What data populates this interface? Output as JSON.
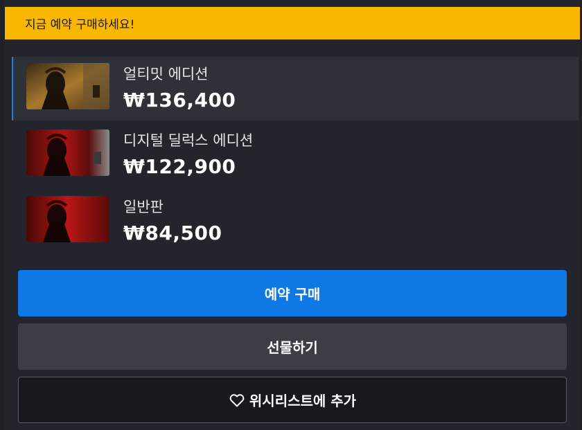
{
  "banner": {
    "text": "지금 예약 구매하세요!"
  },
  "editions": [
    {
      "name": "얼티밋 에디션",
      "price": "₩136,400",
      "selected": true,
      "thumb_icon": "ultimate-edition-art"
    },
    {
      "name": "디지털 딜럭스 에디션",
      "price": "₩122,900",
      "selected": false,
      "thumb_icon": "deluxe-edition-art"
    },
    {
      "name": "일반판",
      "price": "₩84,500",
      "selected": false,
      "thumb_icon": "standard-edition-art"
    }
  ],
  "buttons": {
    "preorder": "예약 구매",
    "gift": "선물하기",
    "wishlist": "위시리스트에 추가"
  },
  "colors": {
    "banner": "#f9b700",
    "primary": "#0e79e5",
    "selected_border": "#1f7ce6",
    "background": "#23252c"
  }
}
